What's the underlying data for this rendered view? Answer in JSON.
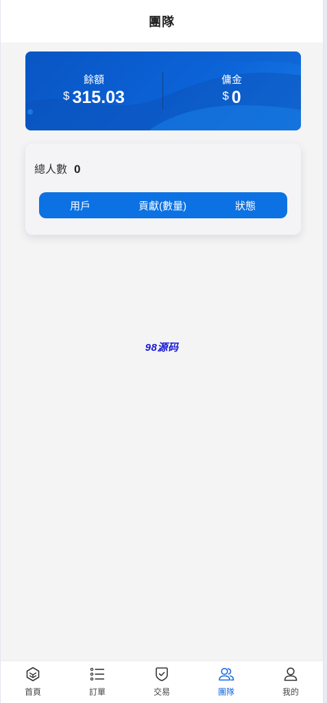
{
  "header": {
    "title": "團隊"
  },
  "balance": {
    "left": {
      "label": "餘額",
      "currency": "$",
      "amount": "315.03"
    },
    "right": {
      "label": "傭金",
      "currency": "$",
      "amount": "0"
    }
  },
  "team": {
    "total_label": "總人數",
    "total_value": "0",
    "columns": [
      "用戶",
      "貢獻(數量)",
      "狀態"
    ]
  },
  "watermark": "98源码",
  "tabbar": {
    "items": [
      {
        "label": "首頁",
        "icon": "home-cube-icon",
        "active": false
      },
      {
        "label": "訂單",
        "icon": "list-icon",
        "active": false
      },
      {
        "label": "交易",
        "icon": "shield-check-icon",
        "active": false
      },
      {
        "label": "團隊",
        "icon": "team-icon",
        "active": true
      },
      {
        "label": "我的",
        "icon": "user-icon",
        "active": false
      }
    ]
  },
  "colors": {
    "accent": "#1769e0",
    "card_gradient_start": "#0a55c4",
    "card_gradient_end": "#1677e6",
    "table_header": "#0c72e3"
  }
}
